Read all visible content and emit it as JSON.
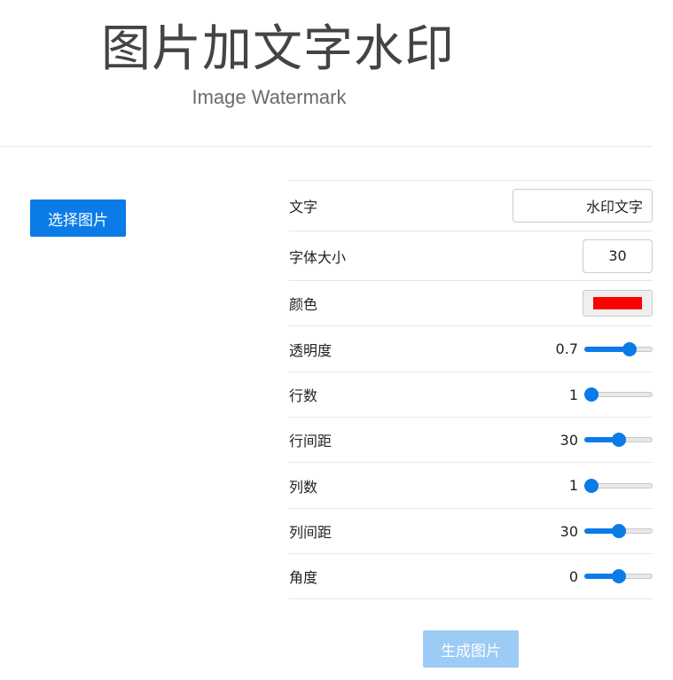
{
  "header": {
    "title": "图片加文字水印",
    "subtitle": "Image Watermark"
  },
  "select_button": "选择图片",
  "generate_button": "生成图片",
  "settings": {
    "text": {
      "label": "文字",
      "value": "水印文字"
    },
    "font_size": {
      "label": "字体大小",
      "value": "30"
    },
    "color": {
      "label": "颜色",
      "value": "#ff0000"
    },
    "opacity": {
      "label": "透明度",
      "value": "0.7",
      "fraction": 0.7
    },
    "rows": {
      "label": "行数",
      "value": "1",
      "fraction": 0.0
    },
    "row_spacing": {
      "label": "行间距",
      "value": "30",
      "fraction": 0.5
    },
    "cols": {
      "label": "列数",
      "value": "1",
      "fraction": 0.0
    },
    "col_spacing": {
      "label": "列间距",
      "value": "30",
      "fraction": 0.5
    },
    "angle": {
      "label": "角度",
      "value": "0",
      "fraction": 0.5
    }
  },
  "colors": {
    "accent": "#0b7be7",
    "accent_disabled": "#9ccbf5"
  }
}
